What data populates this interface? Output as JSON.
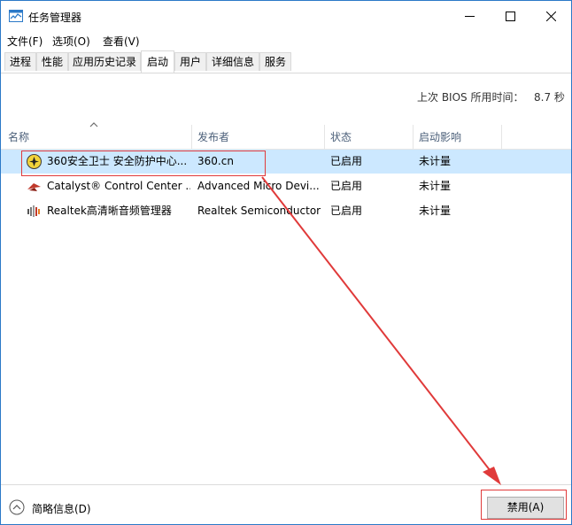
{
  "window": {
    "title": "任务管理器",
    "minimize_glyph": "—",
    "maximize_glyph": "☐",
    "close_glyph": "✕"
  },
  "menu": [
    "文件(F)",
    "选项(O)",
    "查看(V)"
  ],
  "tabs": [
    {
      "label": "进程",
      "active": false
    },
    {
      "label": "性能",
      "active": false
    },
    {
      "label": "应用历史记录",
      "active": false
    },
    {
      "label": "启动",
      "active": true
    },
    {
      "label": "用户",
      "active": false
    },
    {
      "label": "详细信息",
      "active": false
    },
    {
      "label": "服务",
      "active": false
    }
  ],
  "bios": {
    "label": "上次 BIOS 所用时间：",
    "value": "8.7 秒"
  },
  "columns": [
    "名称",
    "发布者",
    "状态",
    "启动影响"
  ],
  "rows": [
    {
      "name": "360安全卫士 安全防护中心...",
      "publisher": "360.cn",
      "status": "已启用",
      "impact": "未计量",
      "icon": "360-safeguard-icon",
      "selected": true
    },
    {
      "name": "Catalyst® Control Center ...",
      "publisher": "Advanced Micro Devi...",
      "status": "已启用",
      "impact": "未计量",
      "icon": "amd-catalyst-icon",
      "selected": false
    },
    {
      "name": "Realtek高清晰音频管理器",
      "publisher": "Realtek Semiconductor",
      "status": "已启用",
      "impact": "未计量",
      "icon": "realtek-audio-icon",
      "selected": false
    }
  ],
  "footer": {
    "collapse_label": "简略信息(D)",
    "disable_button": "禁用(A)"
  },
  "colors": {
    "accent": "#2b79c8",
    "selection": "#cce8ff",
    "annotation": "#e03a3a"
  }
}
